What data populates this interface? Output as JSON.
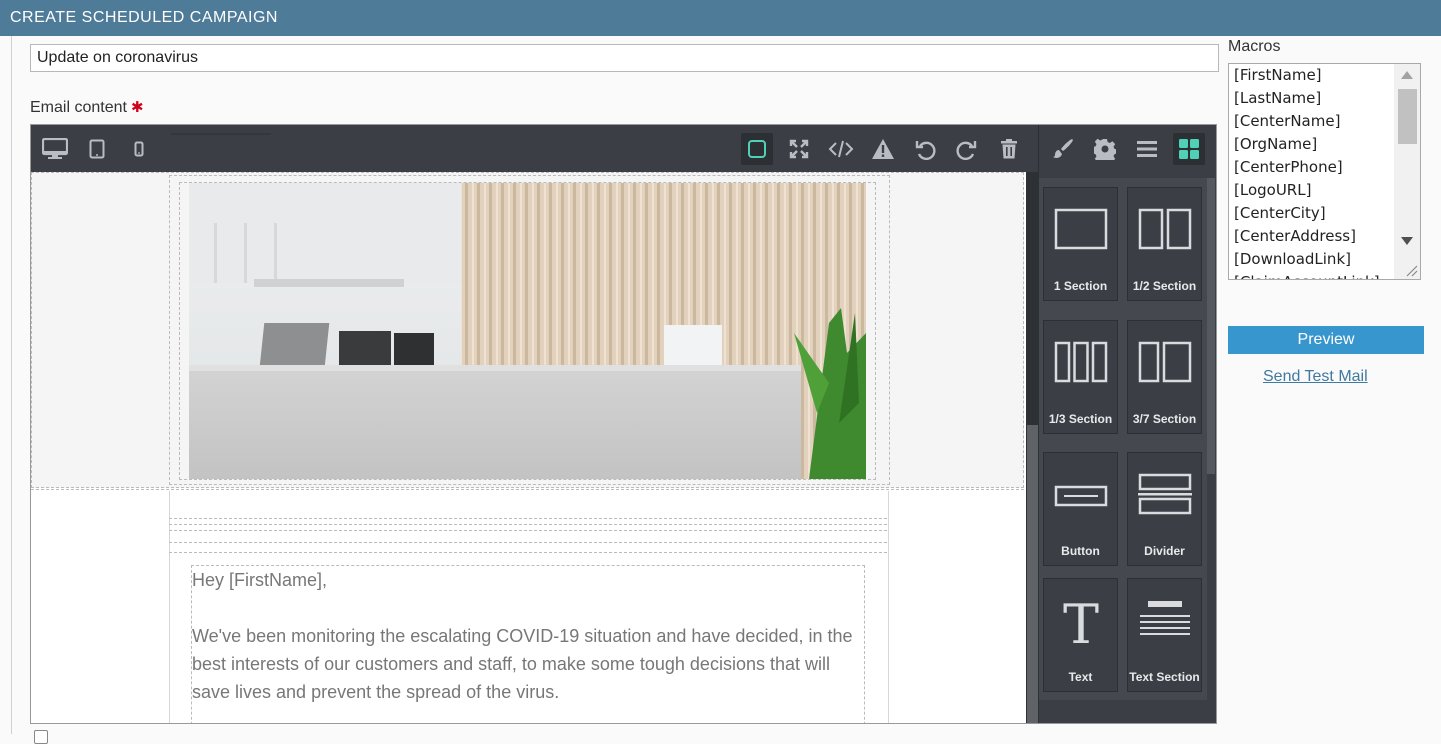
{
  "header": {
    "title": "CREATE SCHEDULED CAMPAIGN"
  },
  "subject": {
    "value": "Update on coronavirus"
  },
  "email_content": {
    "label": "Email content",
    "required_mark": "✱"
  },
  "toolbar": {
    "left_icons": [
      "desktop-icon",
      "tablet-icon",
      "mobile-icon"
    ],
    "right_icons": [
      "view-components-icon",
      "fullscreen-icon",
      "code-icon",
      "warning-icon",
      "undo-icon",
      "redo-icon",
      "trash-icon"
    ],
    "panel_icons": [
      "style-manager-icon",
      "settings-icon",
      "layer-manager-icon",
      "blocks-icon"
    ],
    "active_color": "#4fd1b5"
  },
  "email_body": {
    "greeting": "Hey [FirstName],",
    "paragraph": "We've been monitoring the escalating COVID-19 situation and have decided, in the best interests of our customers and staff, to make some tough decisions that will save lives and prevent the spread of the virus."
  },
  "blocks": {
    "items": [
      {
        "label": "1 Section",
        "icon": "one-section-icon"
      },
      {
        "label": "1/2 Section",
        "icon": "half-section-icon"
      },
      {
        "label": "1/3 Section",
        "icon": "third-section-icon"
      },
      {
        "label": "3/7 Section",
        "icon": "three-seventh-section-icon"
      },
      {
        "label": "Button",
        "icon": "button-block-icon"
      },
      {
        "label": "Divider",
        "icon": "divider-block-icon"
      },
      {
        "label": "Text",
        "icon": "text-block-icon"
      },
      {
        "label": "Text Section",
        "icon": "text-section-block-icon"
      }
    ]
  },
  "macros": {
    "label": "Macros",
    "items": [
      "[FirstName]",
      "[LastName]",
      "[CenterName]",
      "[OrgName]",
      "[CenterPhone]",
      "[LogoURL]",
      "[CenterCity]",
      "[CenterAddress]",
      "[DownloadLink]",
      "[ClaimAccountLink]"
    ]
  },
  "actions": {
    "preview_label": "Preview",
    "test_mail_label": "Send Test Mail",
    "preview_color": "#3896ce"
  },
  "colors": {
    "header_bg": "#4e7b98",
    "editor_toolbar_bg": "#3b3f45",
    "required": "#d0021b"
  }
}
